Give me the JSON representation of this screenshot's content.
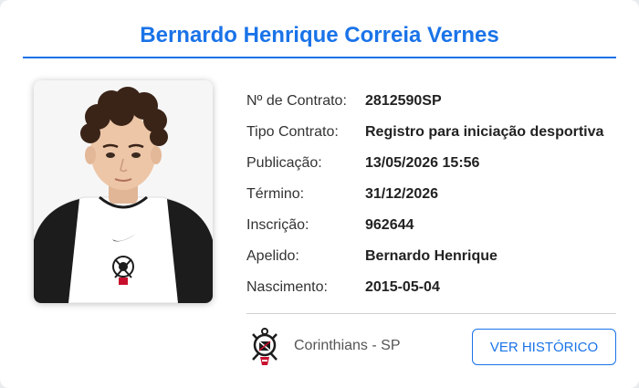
{
  "player": {
    "name": "Bernardo Henrique Correia Vernes"
  },
  "fields": [
    {
      "label": "Nº de Contrato:",
      "value": "2812590SP"
    },
    {
      "label": "Tipo Contrato:",
      "value": "Registro para iniciação desportiva"
    },
    {
      "label": "Publicação:",
      "value": "13/05/2026 15:56"
    },
    {
      "label": "Término:",
      "value": "31/12/2026"
    },
    {
      "label": "Inscrição:",
      "value": "962644"
    },
    {
      "label": "Apelido:",
      "value": "Bernardo Henrique"
    },
    {
      "label": "Nascimento:",
      "value": "2015-05-04"
    }
  ],
  "club": {
    "name": "Corinthians - SP",
    "crest_icon": "corinthians-crest-icon"
  },
  "actions": {
    "history_label": "VER HISTÓRICO"
  },
  "colors": {
    "accent": "#1a73e8"
  }
}
